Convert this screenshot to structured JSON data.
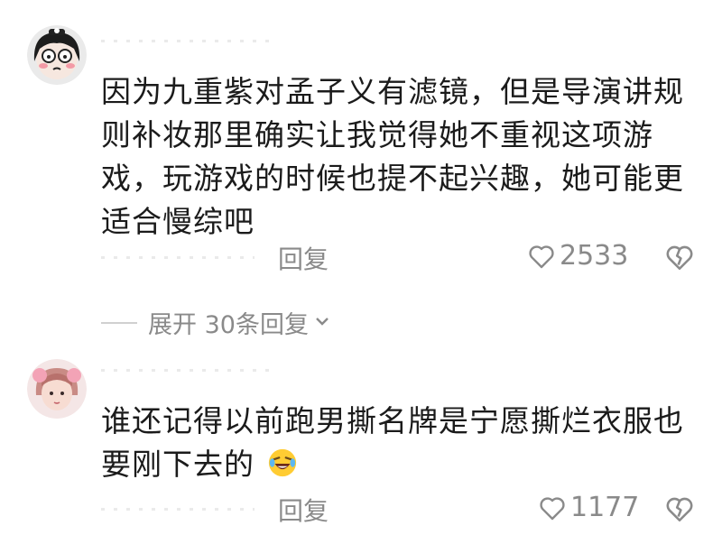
{
  "comments": [
    {
      "text": "因为九重紫对孟子义有滤镜，但是导演讲规则补妆那里确实让我觉得她不重视这项游戏，玩游戏的时候也提不起兴趣，她可能更适合慢综吧",
      "reply_label": "回复",
      "likes": "2533"
    },
    {
      "text": "谁还记得以前跑男撕名牌是宁愿撕烂衣服也要刚下去的",
      "emoji": "rolling-on-floor-laughing-emoji",
      "reply_label": "回复",
      "likes": "1177"
    }
  ],
  "expand_replies": "展开 30条回复"
}
